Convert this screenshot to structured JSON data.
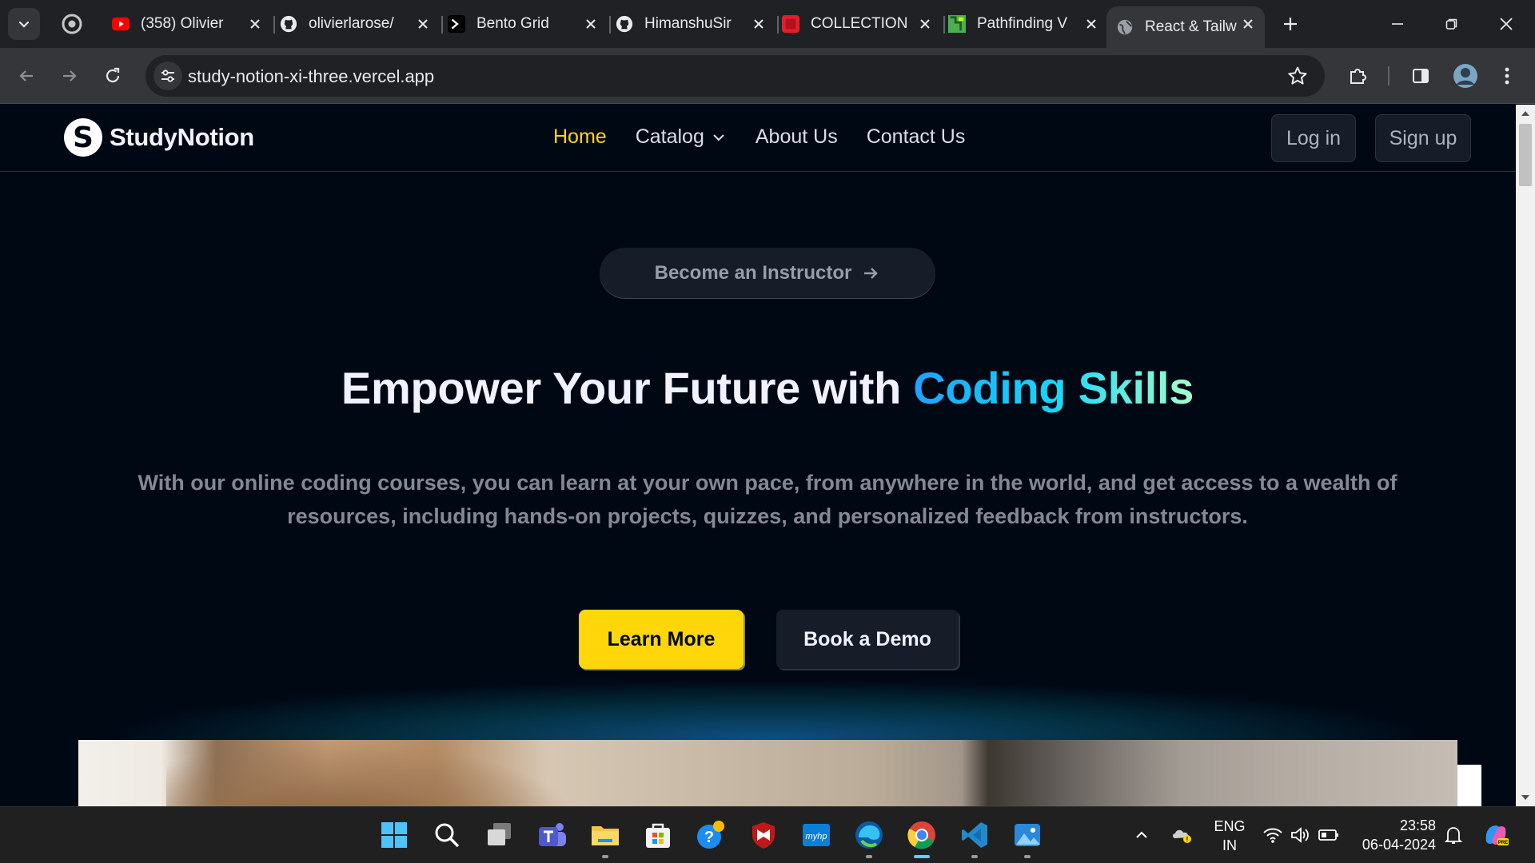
{
  "browser": {
    "tabs": [
      {
        "title": "(358) Olivier",
        "favicon": "youtube-icon"
      },
      {
        "title": "olivierlarose/",
        "favicon": "github-icon"
      },
      {
        "title": "Bento Grid",
        "favicon": "terminal-icon"
      },
      {
        "title": "HimanshuSir",
        "favicon": "github-icon"
      },
      {
        "title": "COLLECTION",
        "favicon": "red-square-icon"
      },
      {
        "title": "Pathfinding V",
        "favicon": "pathfinding-icon"
      },
      {
        "title": "React & Tailw",
        "favicon": "globe-icon",
        "active": true
      }
    ],
    "url": "study-notion-xi-three.vercel.app"
  },
  "site": {
    "brand": "StudyNotion",
    "brand_mark": "S",
    "nav": {
      "home": "Home",
      "catalog": "Catalog",
      "about": "About Us",
      "contact": "Contact Us"
    },
    "login": "Log in",
    "signup": "Sign up",
    "instructor_pill": "Become an Instructor",
    "headline_prefix": "Empower Your Future with ",
    "headline_highlight": "Coding Skills",
    "subtext": "With our online coding courses, you can learn at your own pace, from anywhere in the world, and get access to a wealth of resources, including hands-on projects, quizzes, and personalized feedback from instructors.",
    "cta_primary": "Learn More",
    "cta_secondary": "Book a Demo"
  },
  "taskbar": {
    "apps": [
      "windows-start-icon",
      "search-icon",
      "task-view-icon",
      "teams-icon",
      "file-explorer-icon",
      "microsoft-store-icon",
      "get-help-icon",
      "mcafee-icon",
      "myhp-icon",
      "edge-icon",
      "chrome-icon",
      "vscode-icon",
      "photos-icon"
    ],
    "lang_top": "ENG",
    "lang_bottom": "IN",
    "time": "23:58",
    "date": "06-04-2024"
  },
  "colors": {
    "page_bg": "#000814",
    "accent_yellow": "#ffd60a",
    "panel": "#161d29",
    "muted_text": "#838894"
  }
}
